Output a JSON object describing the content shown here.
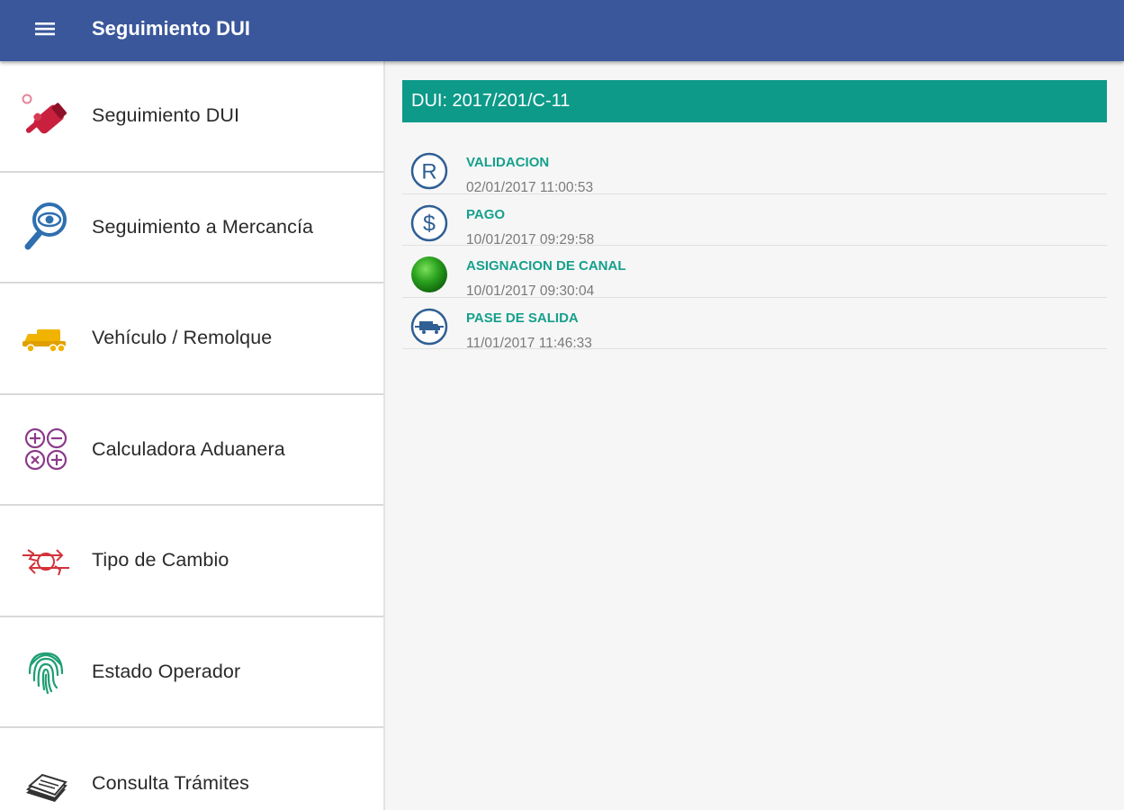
{
  "app": {
    "title": "Seguimiento DUI"
  },
  "sidebar": {
    "items": [
      {
        "label": "Seguimiento DUI",
        "icon": "pointing-hand-icon"
      },
      {
        "label": "Seguimiento a Mercancía",
        "icon": "magnifier-eye-icon"
      },
      {
        "label": "Vehículo / Remolque",
        "icon": "truck-icon"
      },
      {
        "label": "Calculadora Aduanera",
        "icon": "calculator-icon"
      },
      {
        "label": "Tipo de Cambio",
        "icon": "exchange-icon"
      },
      {
        "label": "Estado Operador",
        "icon": "fingerprint-icon"
      },
      {
        "label": "Consulta Trámites",
        "icon": "documents-icon"
      }
    ]
  },
  "main": {
    "dui_label": "DUI: 2017/201/C-11",
    "events": [
      {
        "title": "VALIDACION",
        "date": "02/01/2017 11:00:53",
        "icon": "registered-icon"
      },
      {
        "title": "PAGO",
        "date": "10/01/2017 09:29:58",
        "icon": "dollar-icon"
      },
      {
        "title": "ASIGNACION DE CANAL",
        "date": "10/01/2017 09:30:04",
        "icon": "green-channel-icon"
      },
      {
        "title": "PASE DE SALIDA",
        "date": "11/01/2017 11:46:33",
        "icon": "truck-exit-icon"
      }
    ]
  },
  "colors": {
    "appbar": "#3a579b",
    "dui_header": "#0d9a89",
    "event_title": "#16a08c",
    "icon_blue": "#2f5f93",
    "channel_green": "#2aa11f"
  }
}
